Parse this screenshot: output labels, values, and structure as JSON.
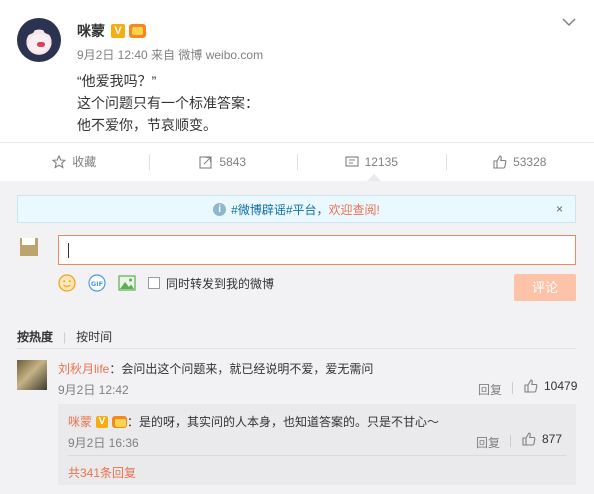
{
  "post": {
    "author": "咪蒙",
    "meta": "9月2日 12:40 来自 微博 weibo.com",
    "lines": [
      "“他爱我吗？”",
      "这个问题只有一个标准答案：",
      "他不爱你，节哀顺变。"
    ],
    "vip_badge": "V"
  },
  "actions": {
    "favorite": "收藏",
    "forward": "5843",
    "comment": "12135",
    "like": "53328"
  },
  "notice": {
    "info_glyph": "i",
    "prefix": "#微博辟谣#平台，",
    "highlight": "欢迎查阅!",
    "close": "×"
  },
  "composer": {
    "forward_label": "同时转发到我的微博",
    "submit_label": "评论"
  },
  "sort": {
    "hot": "按热度",
    "time": "按时间"
  },
  "comment": {
    "user": "刘秋月life",
    "text": "：会问出这个问题来，就已经说明不爱，爱无需问",
    "time": "9月2日 12:42",
    "reply": "回复",
    "likes": "10479"
  },
  "sub_comment": {
    "user": "咪蒙",
    "vip_badge": "V",
    "text": "：是的呀，其实问的人本身，也知道答案的。只是不甘心～",
    "time": "9月2日 16:36",
    "reply": "回复",
    "likes": "877",
    "more": "共341条回复"
  },
  "colors": {
    "accent": "#eb7350",
    "notice_bg": "#eaf8ff",
    "submit_disabled": "#fdc3a9",
    "comments_bg": "#f2f2f5"
  }
}
